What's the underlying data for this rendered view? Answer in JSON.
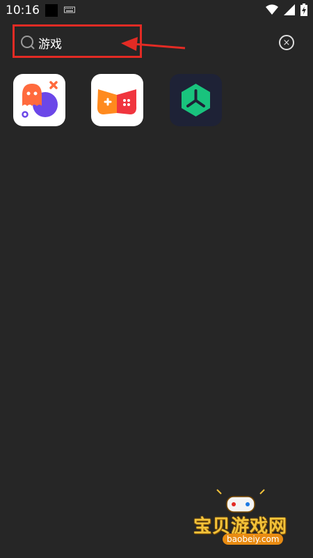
{
  "status_bar": {
    "time": "10:16"
  },
  "search": {
    "query": "游戏"
  },
  "clear": {
    "glyph": "×"
  },
  "apps": [
    {
      "icon": "ghost-game-app-icon"
    },
    {
      "icon": "gamepad-app-icon"
    },
    {
      "icon": "green-hexagon-app-icon"
    }
  ],
  "watermark": {
    "title": "宝贝游戏网",
    "url": "baobeiy.com"
  },
  "colors": {
    "background": "#262626",
    "highlight": "#e32b24"
  }
}
